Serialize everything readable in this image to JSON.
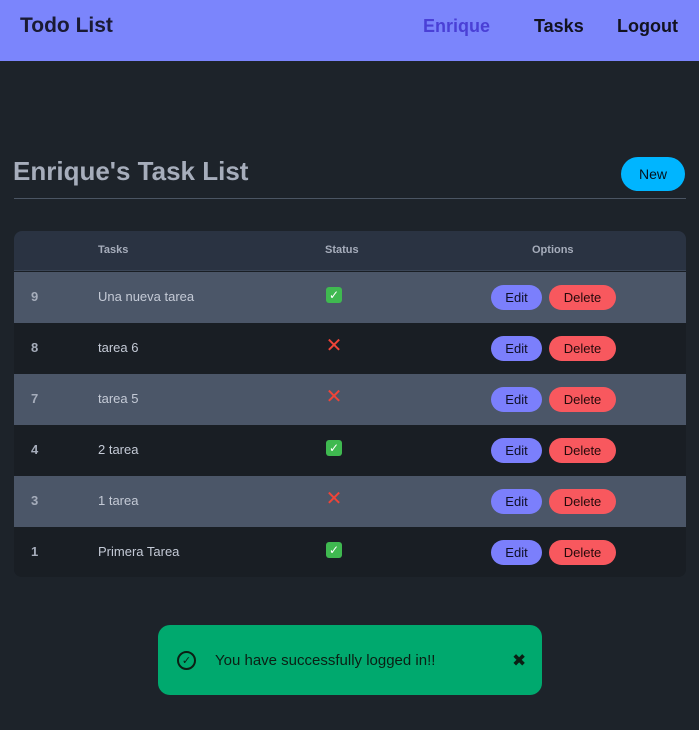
{
  "navbar": {
    "brand": "Todo List",
    "user_link": "Enrique",
    "tasks_link": "Tasks",
    "logout_link": "Logout",
    "background": "#7b85fc",
    "active_color": "#4a40d6"
  },
  "main": {
    "title": "Enrique's Task List",
    "new_button": "New"
  },
  "table": {
    "headers": {
      "id": "",
      "tasks": "Tasks",
      "status": "Status",
      "options": "Options"
    },
    "rows": [
      {
        "id": "9",
        "task": "Una nueva tarea",
        "status": "done",
        "status_icon": "check-mark-icon",
        "edit": "Edit",
        "delete": "Delete"
      },
      {
        "id": "8",
        "task": "tarea 6",
        "status": "not-done",
        "status_icon": "cross-mark-icon",
        "edit": "Edit",
        "delete": "Delete"
      },
      {
        "id": "7",
        "task": "tarea 5",
        "status": "not-done",
        "status_icon": "cross-mark-icon",
        "edit": "Edit",
        "delete": "Delete"
      },
      {
        "id": "4",
        "task": "2 tarea",
        "status": "done",
        "status_icon": "check-mark-icon",
        "edit": "Edit",
        "delete": "Delete"
      },
      {
        "id": "3",
        "task": "1 tarea",
        "status": "not-done",
        "status_icon": "cross-mark-icon",
        "edit": "Edit",
        "delete": "Delete"
      },
      {
        "id": "1",
        "task": "Primera Tarea",
        "status": "done",
        "status_icon": "check-mark-icon",
        "edit": "Edit",
        "delete": "Delete"
      }
    ]
  },
  "toast": {
    "message": "You have successfully logged in!!",
    "icon": "check-circle-icon",
    "close_icon": "close-icon",
    "background": "#00a96e"
  }
}
